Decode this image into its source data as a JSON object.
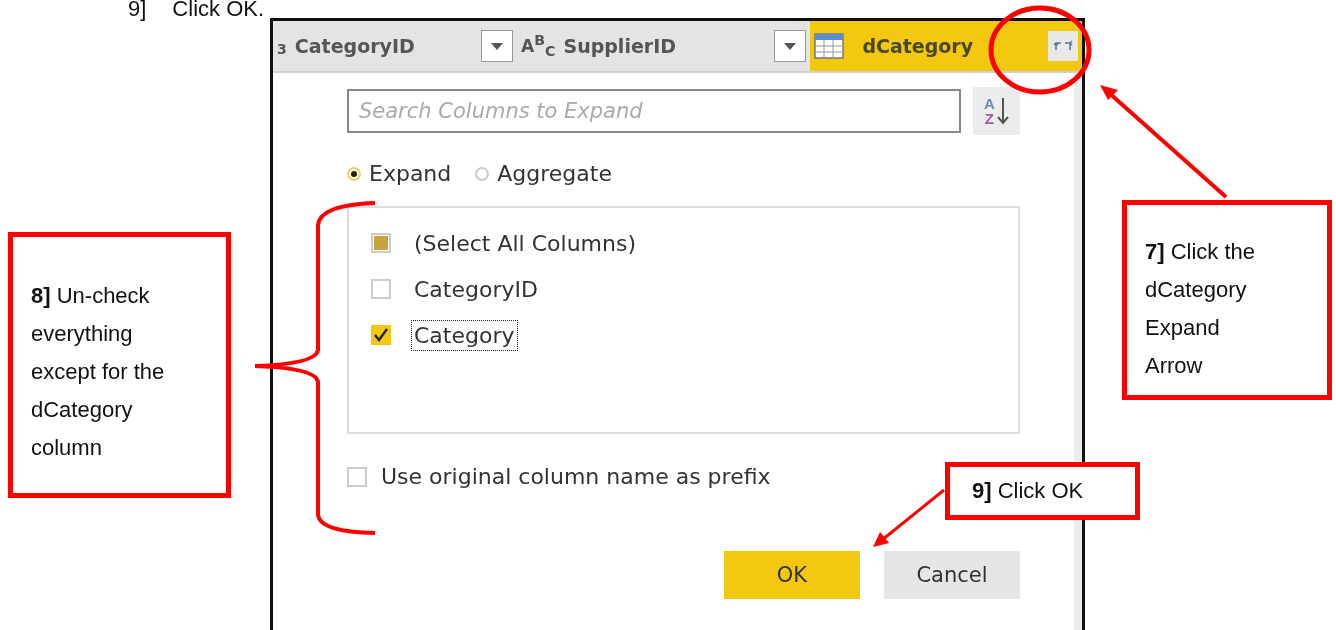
{
  "instruction": {
    "step": "9]",
    "text": "Click OK."
  },
  "column_headers": [
    {
      "kind": "number",
      "type_label": "$_{3}$",
      "label": "CategoryID",
      "selected": false
    },
    {
      "kind": "text",
      "type_label": "A$^{B}$$_{C}$",
      "label": "SupplierID",
      "selected": false
    },
    {
      "kind": "table",
      "label": "dCategory",
      "selected": true
    }
  ],
  "expand_dialog": {
    "search": {
      "placeholder": "Search Columns to Expand"
    },
    "sort_button": {
      "letters": [
        "A",
        "Z"
      ]
    },
    "modes": [
      {
        "label": "Expand",
        "selected": true
      },
      {
        "label": "Aggregate",
        "selected": false
      }
    ],
    "columns": [
      {
        "label": "(Select All Columns)",
        "checked": false,
        "indeterminate": true,
        "focused": false
      },
      {
        "label": "CategoryID",
        "checked": false,
        "indeterminate": false,
        "focused": false
      },
      {
        "label": "Category",
        "checked": true,
        "indeterminate": false,
        "focused": true
      }
    ],
    "prefix_option": {
      "label": "Use original column name as prefix",
      "checked": false
    },
    "buttons": [
      {
        "label": "OK",
        "kind": "primary"
      },
      {
        "label": "Cancel",
        "kind": "secondary"
      }
    ]
  },
  "callouts": [
    {
      "step": "8]",
      "text": "Un-check everything except for the dCategory column"
    },
    {
      "step": "7]",
      "text": "Click the dCategory Expand Arrow"
    },
    {
      "step": "9]",
      "text": "Click OK"
    }
  ]
}
